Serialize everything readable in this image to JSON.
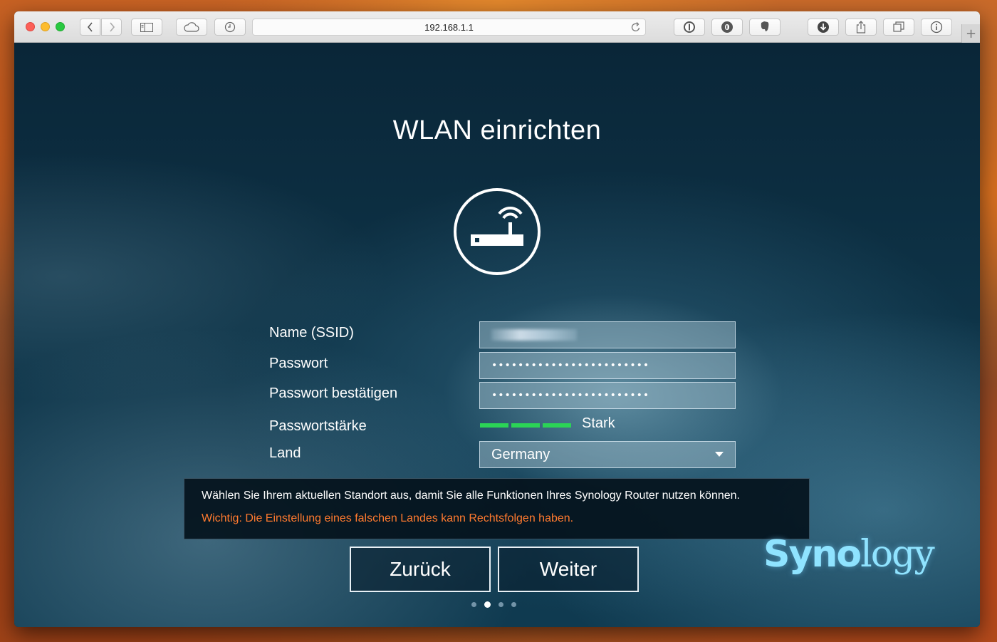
{
  "browser": {
    "address": "192.168.1.1"
  },
  "page": {
    "title": "WLAN einrichten",
    "form": {
      "ssid_label": "Name (SSID)",
      "password_label": "Passwort",
      "password_value": "••••••••••••••••••••••••",
      "confirm_label": "Passwort bestätigen",
      "confirm_value": "••••••••••••••••••••••••",
      "strength_label": "Passwortstärke",
      "strength_value": "Stark",
      "strength_level": 1.0,
      "country_label": "Land",
      "country_value": "Germany"
    },
    "notice": {
      "info": "Wählen Sie Ihrem aktuellen Standort aus, damit Sie alle Funktionen Ihres Synology Router nutzen können.",
      "warning": "Wichtig: Die Einstellung eines falschen Landes kann Rechtsfolgen haben."
    },
    "buttons": {
      "back": "Zurück",
      "next": "Weiter"
    },
    "pager": {
      "total": 4,
      "current": 2
    },
    "logo": {
      "bold": "Syno",
      "light": "logy"
    }
  },
  "colors": {
    "strength": "#2bd456",
    "warning": "#ff7a2f",
    "logo": "#8fe3ff"
  }
}
